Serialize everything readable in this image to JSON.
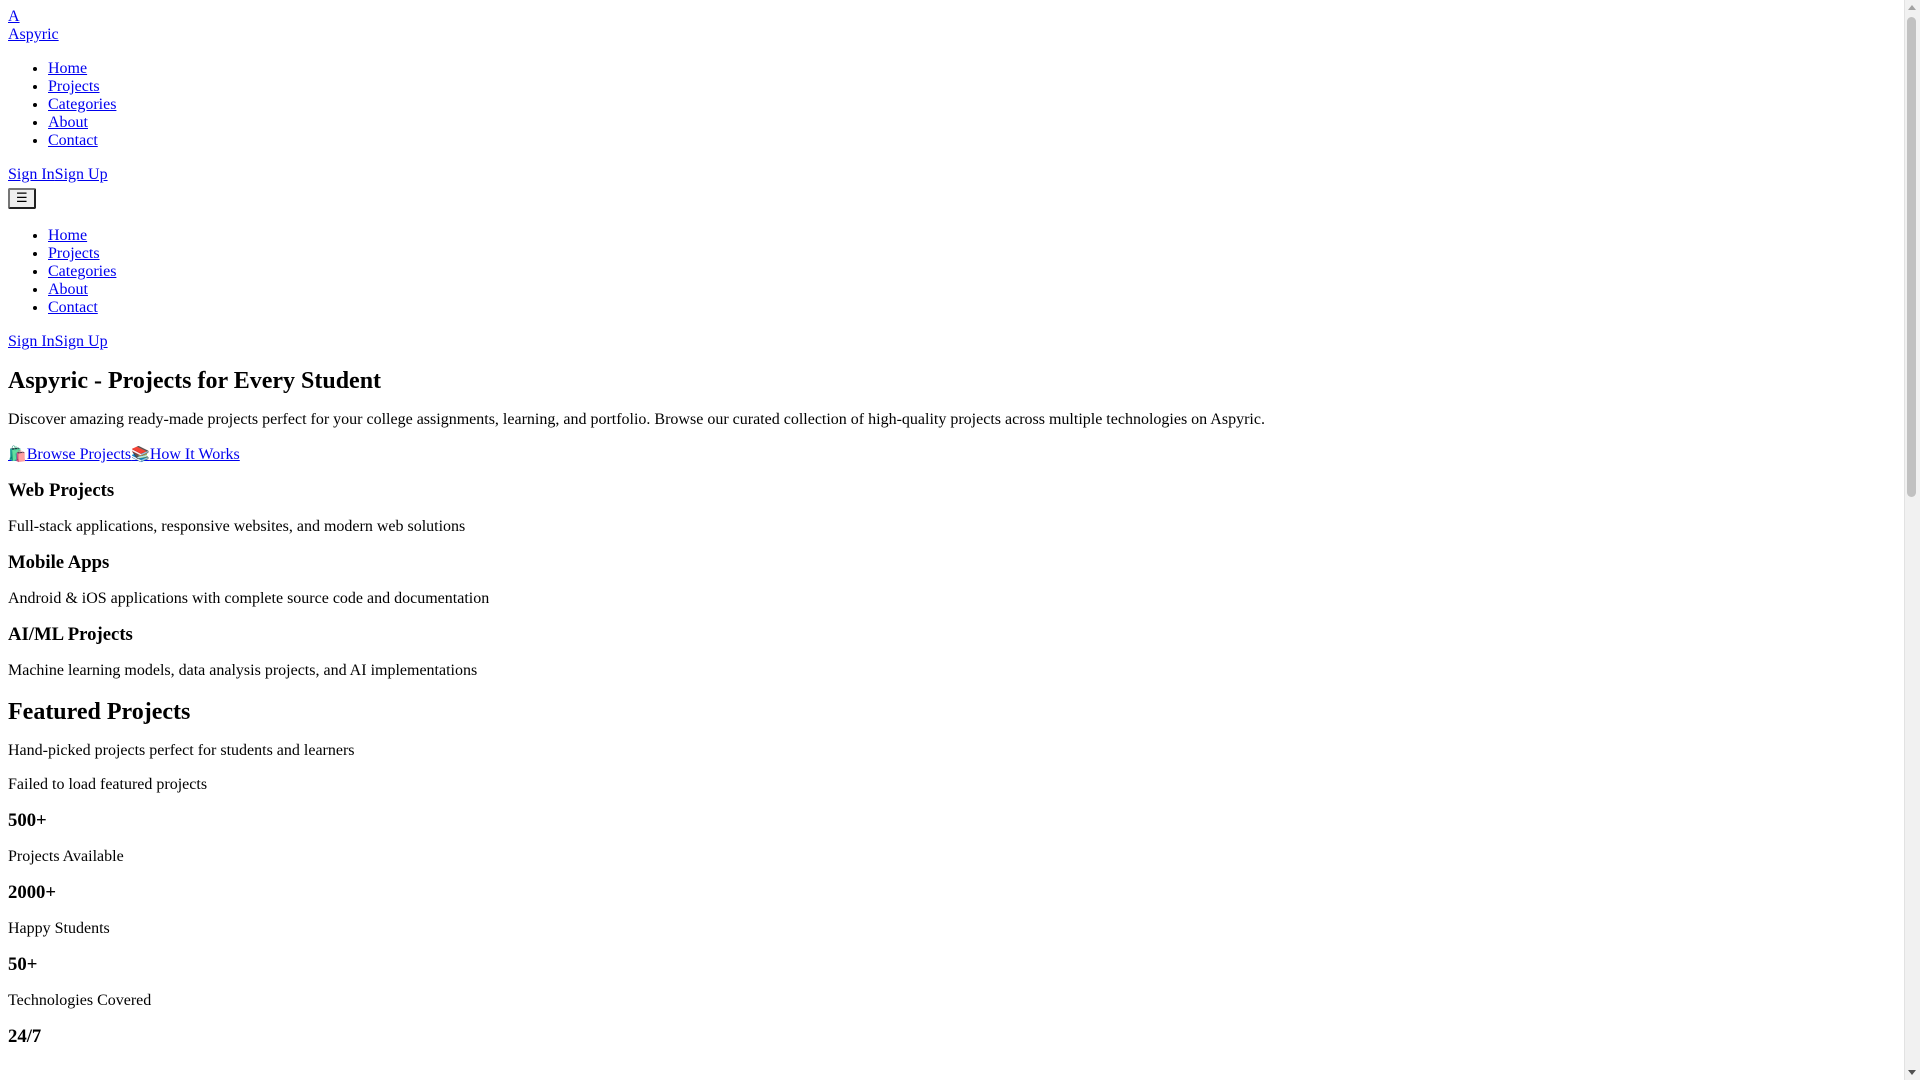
{
  "header": {
    "logo_mark": "A",
    "logo_text": "Aspyric",
    "nav": [
      "Home",
      "Projects",
      "Categories",
      "About",
      "Contact"
    ],
    "sign_in": "Sign In",
    "sign_up": "Sign Up",
    "menu_icon": "☰"
  },
  "mobile_menu": {
    "nav": [
      "Home",
      "Projects",
      "Categories",
      "About",
      "Contact"
    ],
    "sign_in": "Sign In",
    "sign_up": "Sign Up"
  },
  "hero": {
    "title": "Aspyric - Projects for Every Student",
    "description": "Discover amazing ready-made projects perfect for your college assignments, learning, and portfolio. Browse our curated collection of high-quality projects across multiple technologies on Aspyric.",
    "browse_icon": "🛍️",
    "browse_label": "Browse Projects",
    "how_icon": "📚",
    "how_label": "How It Works"
  },
  "categories": [
    {
      "title": "Web Projects",
      "description": "Full-stack applications, responsive websites, and modern web solutions"
    },
    {
      "title": "Mobile Apps",
      "description": "Android & iOS applications with complete source code and documentation"
    },
    {
      "title": "AI/ML Projects",
      "description": "Machine learning models, data analysis projects, and AI implementations"
    }
  ],
  "featured": {
    "title": "Featured Projects",
    "subtitle": "Hand-picked projects perfect for students and learners",
    "error": "Failed to load featured projects"
  },
  "stats": [
    {
      "value": "500+",
      "label": "Projects Available"
    },
    {
      "value": "2000+",
      "label": "Happy Students"
    },
    {
      "value": "50+",
      "label": "Technologies Covered"
    },
    {
      "value": "24/7",
      "label": ""
    }
  ]
}
